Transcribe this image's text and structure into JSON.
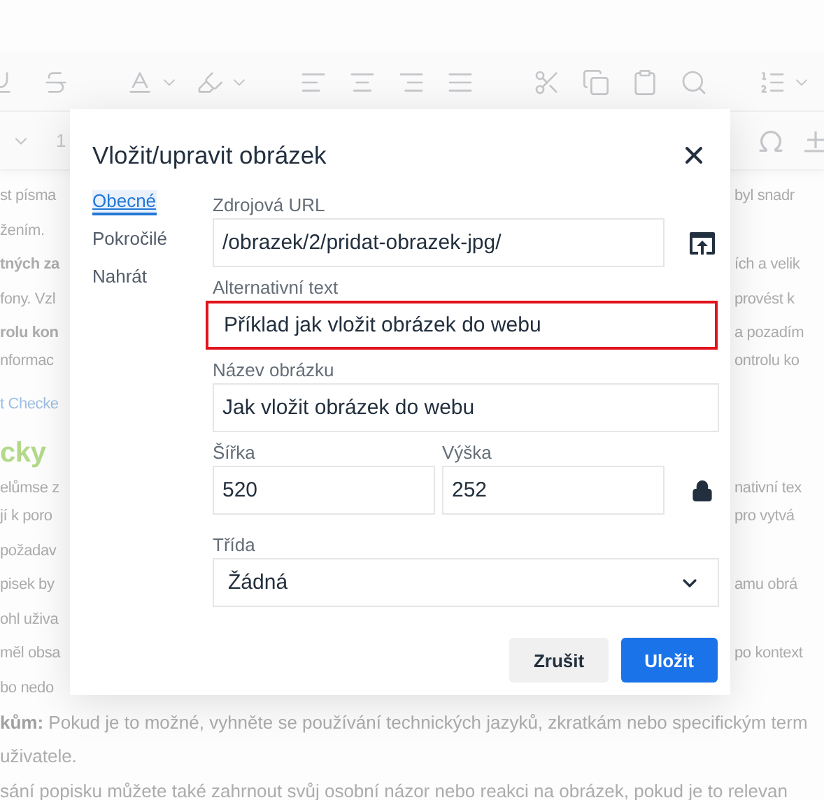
{
  "toolbar": {
    "row_2": {
      "left_text": "1"
    }
  },
  "background_lines": [
    {
      "left": "st písma",
      "right": "byl snadr"
    },
    {
      "left": "žením."
    },
    {
      "left": "tných za",
      "right": "ích a velik",
      "bold_left": true
    },
    {
      "left": "fony. Vzl",
      "right": "provést k"
    },
    {
      "left": "rolu kon",
      "right": "a pozadím",
      "bold_left": true
    },
    {
      "left": "nformac",
      "right": "ontrolu ko"
    },
    {
      "left": "t Checke",
      "kind": "link"
    },
    {
      "left": "cky",
      "kind": "heading"
    },
    {
      "left": "elůmse z",
      "right": "nativní tex"
    },
    {
      "left": "jí k poro",
      "right": "pro vytvá"
    },
    {
      "left": "požadav"
    },
    {
      "left": "pisek by",
      "right": "amu obrá"
    },
    {
      "left": "ohl uživa"
    },
    {
      "left": "měl obsa",
      "right": "po kontext"
    },
    {
      "left": "bo nedo"
    }
  ],
  "background_paragraphs": [
    "**kům:** Pokud je to možné, vyhněte se používání technických jazyků, zkratkám nebo specifickým term",
    "uživatele.",
    "sání popisku můžete také zahrnout svůj osobní názor nebo reakci na obrázek, pokud je to relevan"
  ],
  "dialog": {
    "title": "Vložit/upravit obrázek",
    "tabs": [
      {
        "label": "Obecné",
        "selected": true
      },
      {
        "label": "Pokročilé",
        "selected": false
      },
      {
        "label": "Nahrát",
        "selected": false
      }
    ],
    "source_url": {
      "label": "Zdrojová URL",
      "value": "/obrazek/2/pridat-obrazek-jpg/"
    },
    "alt_text": {
      "label": "Alternativní text",
      "value": "Příklad jak vložit obrázek do webu",
      "highlighted": true
    },
    "image_title": {
      "label": "Název obrázku",
      "value": "Jak vložit obrázek do webu"
    },
    "width": {
      "label": "Šířka",
      "value": "520"
    },
    "height": {
      "label": "Výška",
      "value": "252"
    },
    "constrain_proportions": {
      "locked": true
    },
    "class": {
      "label": "Třída",
      "value": "Žádná"
    },
    "buttons": [
      {
        "label": "Zrušit",
        "kind": "secondary"
      },
      {
        "label": "Uložit",
        "kind": "primary"
      }
    ]
  }
}
